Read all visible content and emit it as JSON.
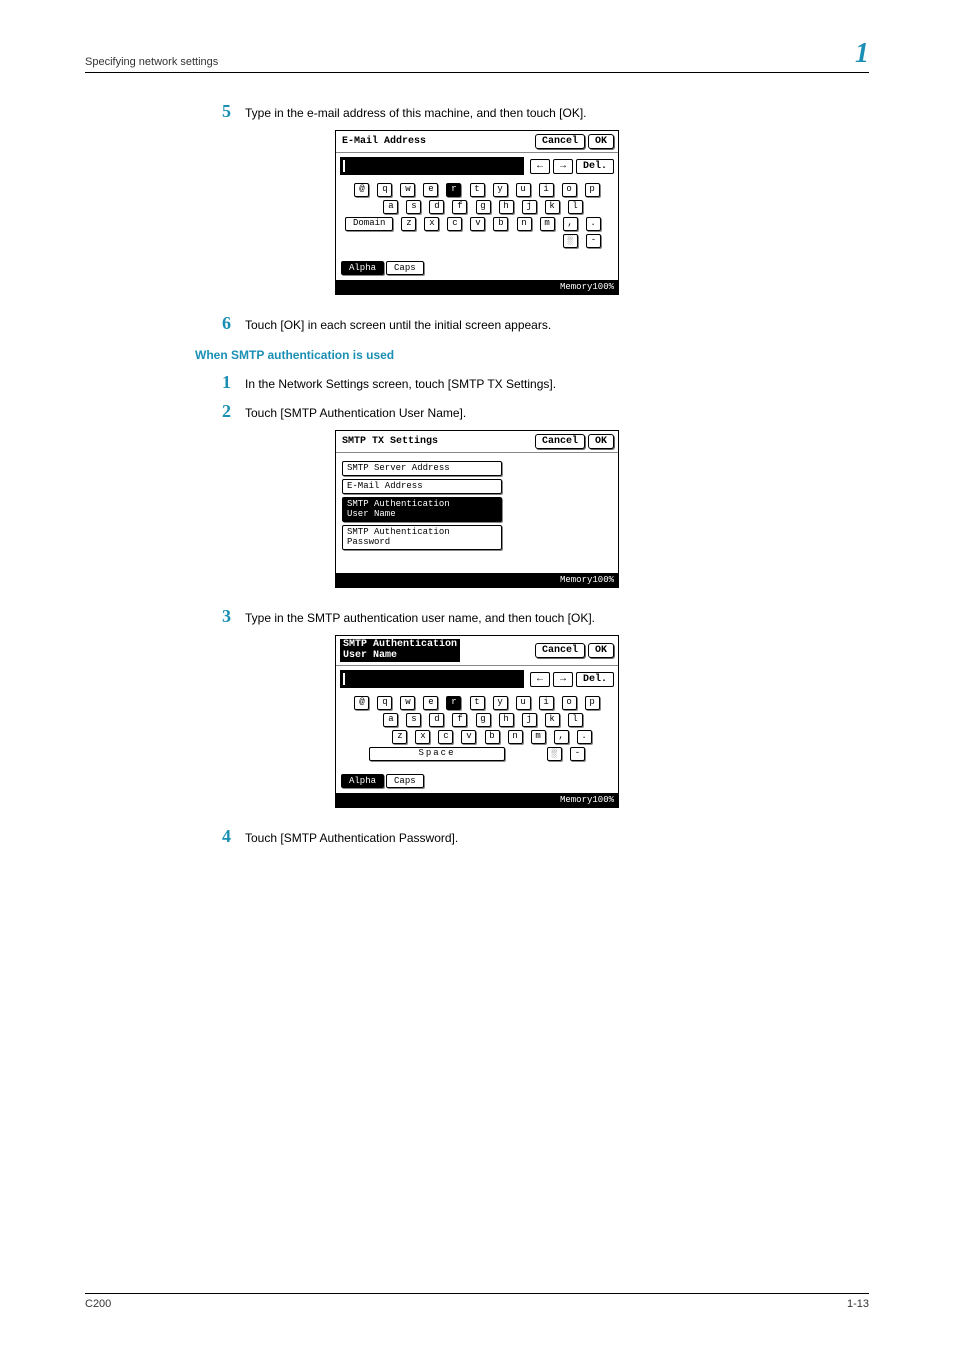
{
  "header": {
    "left": "Specifying network settings",
    "right": "1"
  },
  "subhead": "When SMTP authentication is used",
  "steps": {
    "s5": {
      "n": "5",
      "t": "Type in the e-mail address of this machine, and then touch [OK]."
    },
    "s6": {
      "n": "6",
      "t": "Touch [OK] in each screen until the initial screen appears."
    },
    "a1": {
      "n": "1",
      "t": "In the Network Settings screen, touch [SMTP TX Settings]."
    },
    "a2": {
      "n": "2",
      "t": "Touch [SMTP Authentication User Name]."
    },
    "a3": {
      "n": "3",
      "t": "Type in the SMTP authentication user name, and then touch [OK]."
    },
    "a4": {
      "n": "4",
      "t": "Touch [SMTP Authentication Password]."
    }
  },
  "panel_common": {
    "cancel": "Cancel",
    "ok": "OK",
    "del": "Del.",
    "arrow_l": "←",
    "arrow_r": "→",
    "alpha": "Alpha",
    "caps": "Caps",
    "memory": "Memory100%",
    "space": "Space",
    "row1": [
      "@",
      "q",
      "w",
      "e",
      "r",
      "t",
      "y",
      "u",
      "i",
      "o",
      "p"
    ],
    "row2": [
      "a",
      "s",
      "d",
      "f",
      "g",
      "h",
      "j",
      "k",
      "l"
    ],
    "row3": [
      "z",
      "x",
      "c",
      "v",
      "b",
      "n",
      "m",
      ",",
      "."
    ],
    "domain": "Domain",
    "shift_minus": [
      "░",
      "-"
    ]
  },
  "panel1": {
    "title": "E-Mail Address"
  },
  "panel2": {
    "title": "SMTP TX Settings",
    "items": {
      "i1": "SMTP Server Address",
      "i2": "E-Mail Address",
      "i3": "SMTP Authentication\nUser Name",
      "i4": "SMTP Authentication\nPassword"
    }
  },
  "panel3": {
    "title": "SMTP Authentication\nUser Name"
  },
  "footer": {
    "left": "C200",
    "right": "1-13"
  }
}
